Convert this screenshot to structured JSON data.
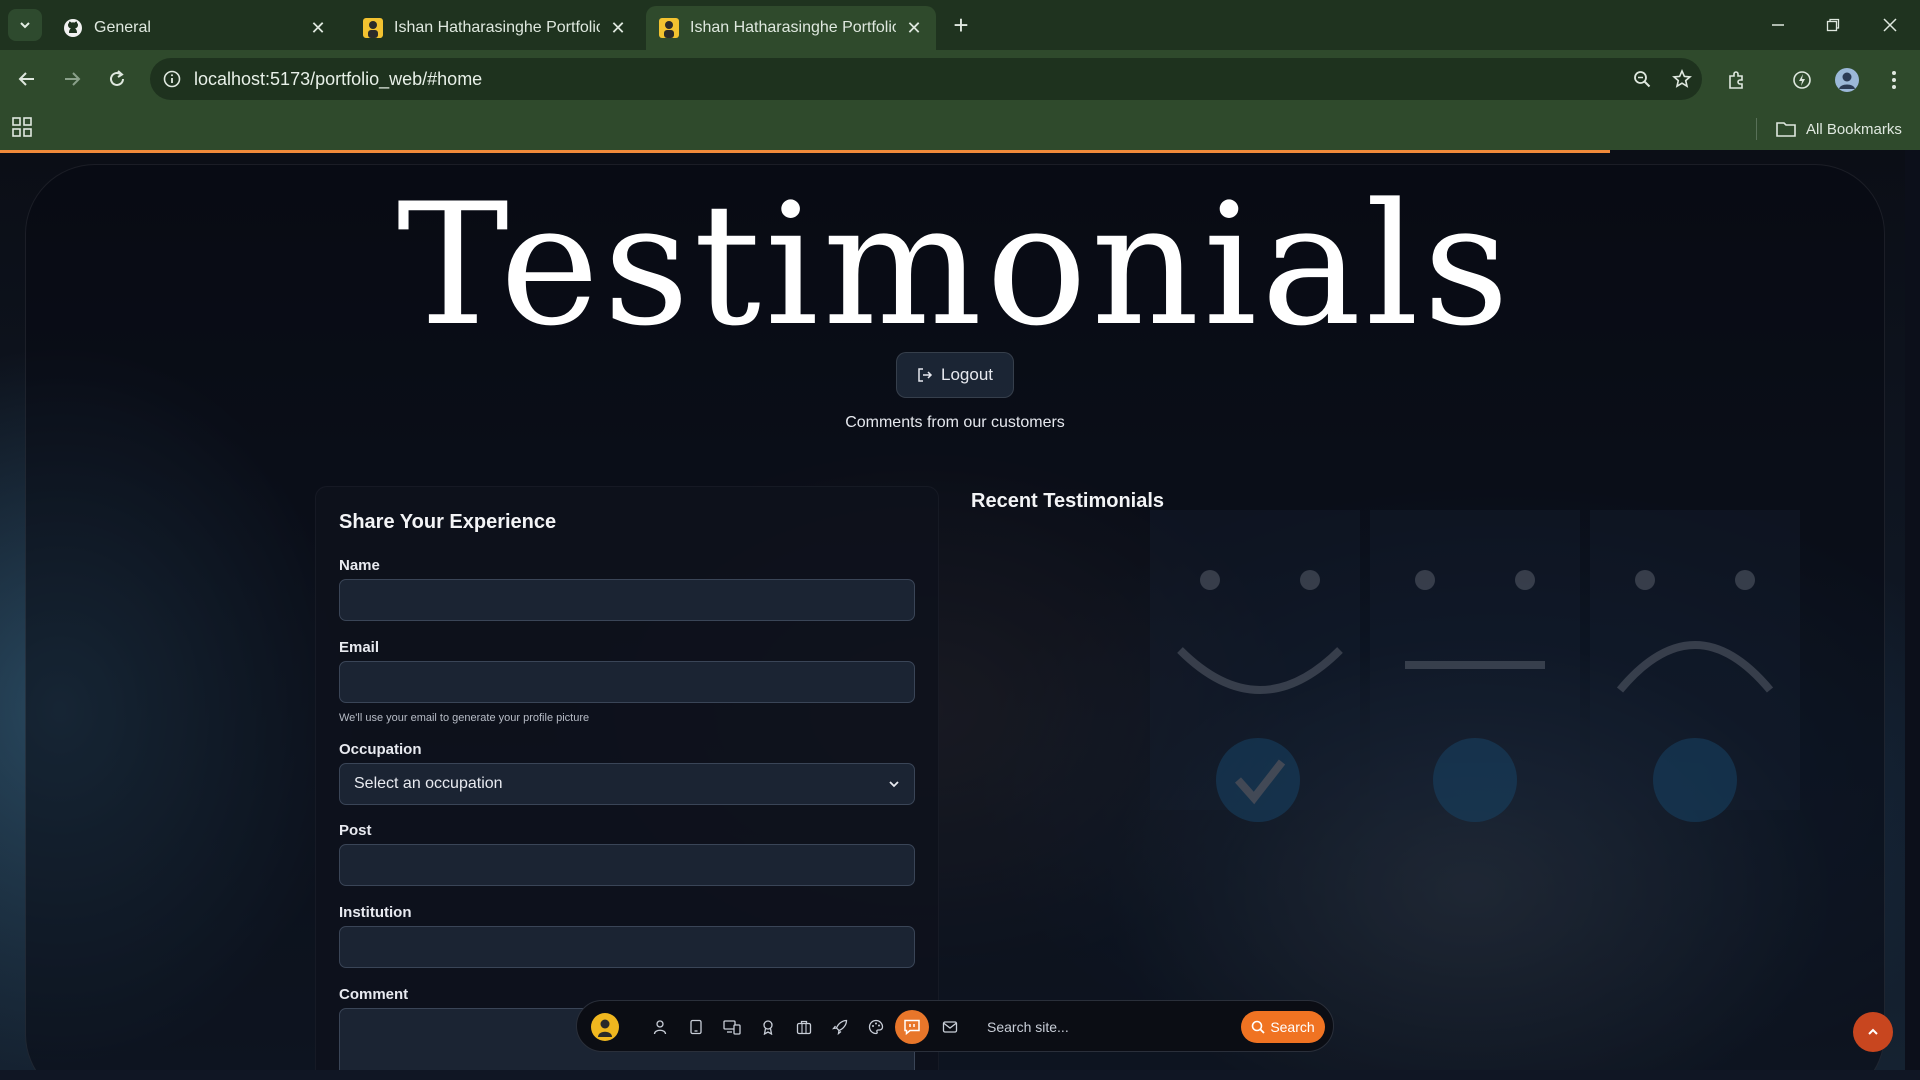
{
  "browser": {
    "tabs": [
      {
        "title": "General",
        "icon": "github-icon",
        "active": false
      },
      {
        "title": "Ishan Hatharasinghe Portfolio",
        "icon": "portfolio-favicon",
        "active": false
      },
      {
        "title": "Ishan Hatharasinghe Portfolio",
        "icon": "portfolio-favicon",
        "active": true
      }
    ],
    "url": "localhost:5173/portfolio_web/#home",
    "bookmarks_label": "All Bookmarks"
  },
  "hero": {
    "title": "Testimonials",
    "logout_label": "Logout",
    "subtitle": "Comments from our customers"
  },
  "form": {
    "title": "Share Your Experience",
    "name_label": "Name",
    "name_value": "",
    "email_label": "Email",
    "email_value": "",
    "email_help": "We'll use your email to generate your profile picture",
    "occupation_label": "Occupation",
    "occupation_selected": "Select an occupation",
    "post_label": "Post",
    "post_value": "",
    "institution_label": "Institution",
    "institution_value": "",
    "comment_label": "Comment"
  },
  "recent": {
    "title": "Recent Testimonials"
  },
  "dock": {
    "icons": [
      "user-icon",
      "tablet-icon",
      "devices-icon",
      "award-icon",
      "briefcase-icon",
      "rocket-icon",
      "palette-icon",
      "message-icon",
      "mail-icon"
    ],
    "active_icon": "message-icon",
    "search_placeholder": "Search site...",
    "search_button": "Search"
  },
  "colors": {
    "accent": "#f07322",
    "progress": "#f08a3a",
    "chrome": "#2f4a2c"
  }
}
